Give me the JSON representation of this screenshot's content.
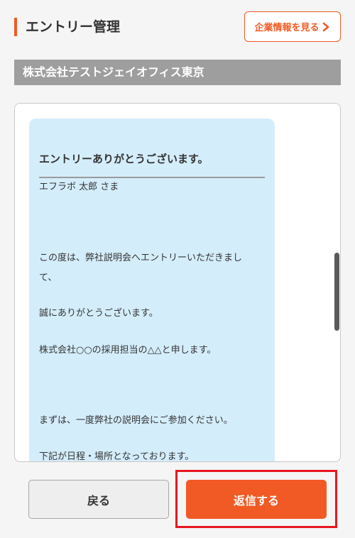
{
  "header": {
    "title": "エントリー管理",
    "company_button_label": "企業情報を見る",
    "company_button_icon": "chevron-right-icon",
    "accent_color": "#f15a24"
  },
  "company": {
    "name": "株式会社テストジェイオフィス東京"
  },
  "message": {
    "title": "エントリーありがとうございます。",
    "lines": [
      "エフラボ 太郎 さま",
      "この度は、弊社説明会へエントリーいただきまし",
      "て、",
      "誠にありがとうございます。",
      "株式会社○○の採用担当の△△と申します。",
      "まずは、一度弊社の説明会にご参加ください。",
      "下記が日程・場所となっております。"
    ],
    "bubble_color": "#d4edfb"
  },
  "actions": {
    "back_label": "戻る",
    "reply_label": "返信する",
    "highlight_color": "#e8171f"
  }
}
